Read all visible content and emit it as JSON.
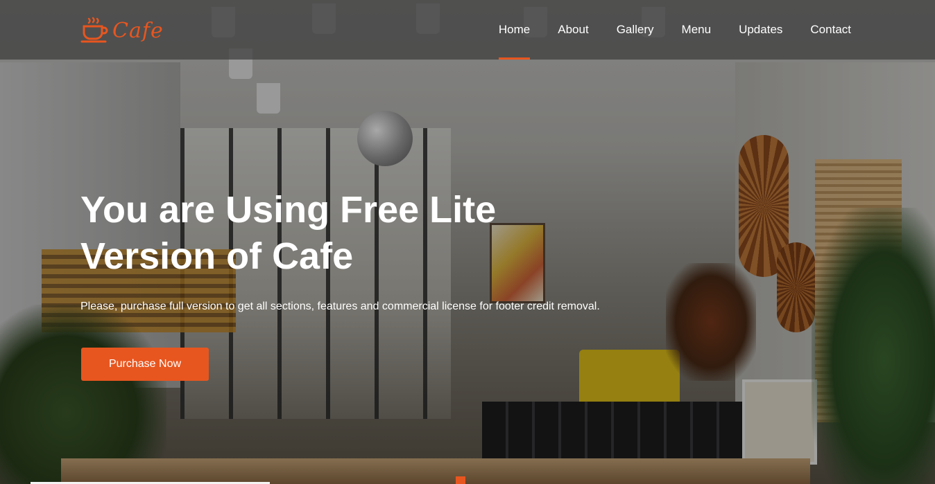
{
  "brand": {
    "name": "Cafe",
    "logo_icon": "coffee-cup-icon",
    "accent_color": "#e8561f"
  },
  "nav": {
    "items": [
      {
        "label": "Home",
        "active": true
      },
      {
        "label": "About",
        "active": false
      },
      {
        "label": "Gallery",
        "active": false
      },
      {
        "label": "Menu",
        "active": false
      },
      {
        "label": "Updates",
        "active": false
      },
      {
        "label": "Contact",
        "active": false
      }
    ]
  },
  "hero": {
    "headline_line1": "You are Using Free Lite",
    "headline_line2": "Version of Cafe",
    "subtext": "Please, purchase full version to get all sections, features and commercial license for footer credit removal.",
    "cta_label": "Purchase Now"
  }
}
